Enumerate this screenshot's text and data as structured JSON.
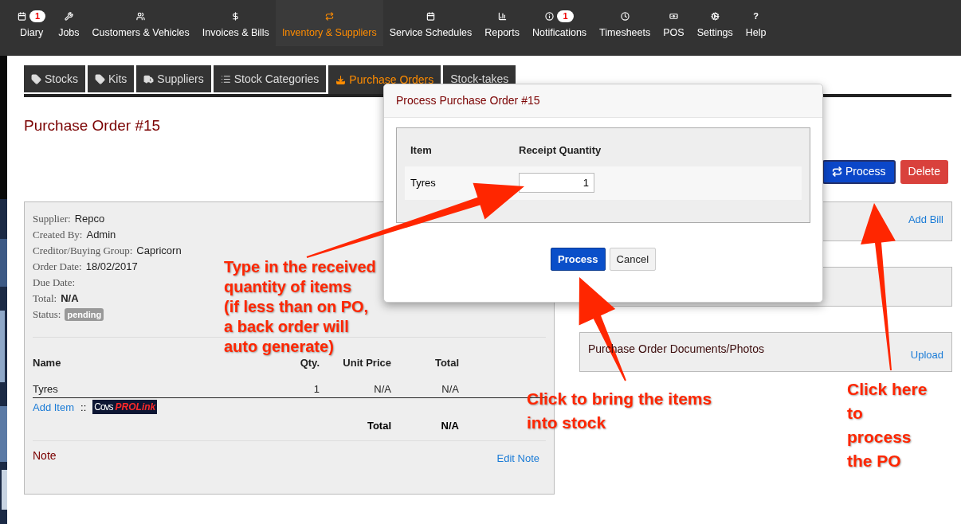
{
  "nav": [
    {
      "label": "Diary",
      "badge": "1",
      "selected": false
    },
    {
      "label": "Jobs",
      "selected": false
    },
    {
      "label": "Customers & Vehicles",
      "selected": false
    },
    {
      "label": "Invoices & Bills",
      "selected": false
    },
    {
      "label": "Inventory & Suppliers",
      "selected": true
    },
    {
      "label": "Service Schedules",
      "selected": false
    },
    {
      "label": "Reports",
      "selected": false
    },
    {
      "label": "Notifications",
      "badge": "1",
      "selected": false
    },
    {
      "label": "Timesheets",
      "selected": false
    },
    {
      "label": "POS",
      "selected": false
    },
    {
      "label": "Settings",
      "selected": false
    },
    {
      "label": "Help",
      "glyph": "?",
      "selected": false
    }
  ],
  "tabs": [
    {
      "label": "Stocks",
      "selected": false
    },
    {
      "label": "Kits",
      "selected": false
    },
    {
      "label": "Suppliers",
      "selected": false
    },
    {
      "label": "Stock Categories",
      "selected": false
    },
    {
      "label": "Purchase Orders",
      "selected": true
    },
    {
      "label": "Stock-takes",
      "selected": false
    }
  ],
  "page_title": "Purchase Order #15",
  "actions": [
    {
      "label": "Process",
      "kind": "primary"
    },
    {
      "label": "Delete",
      "kind": "danger"
    }
  ],
  "details": [
    {
      "label": "Supplier:",
      "value": "Repco"
    },
    {
      "label": "Created By:",
      "value": "Admin"
    },
    {
      "label": "Creditor/Buying Group:",
      "value": "Capricorn"
    },
    {
      "label": "Order Date:",
      "value": "18/02/2017"
    },
    {
      "label": "Due Date:"
    },
    {
      "label": "Total:",
      "value": "N/A",
      "bold": true
    },
    {
      "label": "Status:",
      "badge": "pending"
    }
  ],
  "items_table": {
    "columns": [
      "Name",
      "Qty.",
      "Unit Price",
      "Total"
    ],
    "rows": [
      [
        "Tyres",
        "1",
        "N/A",
        "N/A"
      ]
    ],
    "add_item": "Add Item",
    "separator": "::",
    "logo": [
      "Covs",
      "PROLink"
    ],
    "total_label": "Total",
    "total_value": "N/A"
  },
  "note": {
    "title": "Note",
    "edit": "Edit Note"
  },
  "bill_panel": {
    "link": "Add Bill"
  },
  "documents_panel": {
    "title": "Purchase Order Documents/Photos",
    "link": "Upload"
  },
  "modal": {
    "title": "Process Purchase Order #15",
    "columns": [
      "Item",
      "Receipt Quantity"
    ],
    "rows": [
      {
        "item": "Tyres",
        "quantity": "1"
      }
    ],
    "buttons": [
      {
        "label": "Process",
        "kind": "primary"
      },
      {
        "label": "Cancel",
        "kind": "default"
      }
    ]
  },
  "annotations": [
    {
      "lines": [
        "Type in the received",
        "quantity of items",
        "(if less than on PO,",
        "a back order will",
        "auto generate)"
      ]
    },
    {
      "lines": [
        "Click to bring the items",
        "into stock"
      ]
    },
    {
      "lines": [
        "Click here",
        "to",
        "process",
        "the PO"
      ]
    }
  ]
}
